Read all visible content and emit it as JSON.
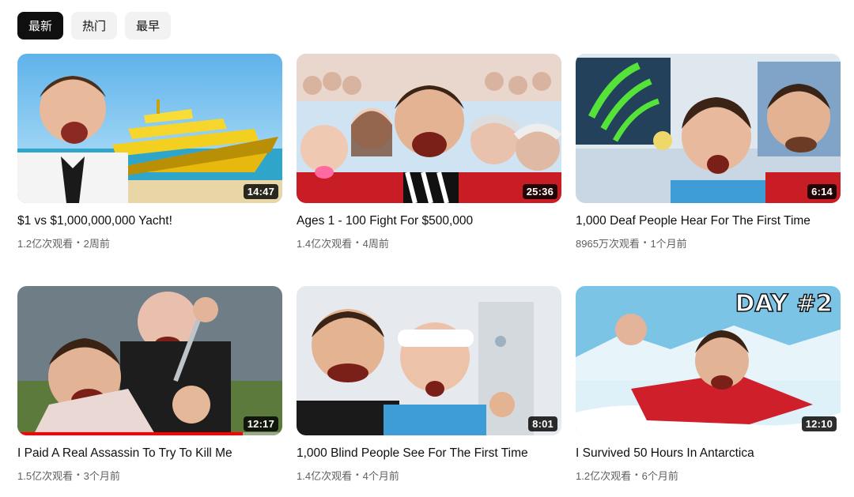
{
  "filters": [
    {
      "label": "最新",
      "active": true
    },
    {
      "label": "热门",
      "active": false
    },
    {
      "label": "最早",
      "active": false
    }
  ],
  "videos": [
    {
      "title": "$1 vs $1,000,000,000 Yacht!",
      "views": "1.2亿次观看",
      "age": "2周前",
      "duration": "14:47"
    },
    {
      "title": "Ages 1 - 100 Fight For $500,000",
      "views": "1.4亿次观看",
      "age": "4周前",
      "duration": "25:36"
    },
    {
      "title": "1,000 Deaf People Hear For The First Time",
      "views": "8965万次观看",
      "age": "1个月前",
      "duration": "6:14"
    },
    {
      "title": "I Paid A Real Assassin To Try To Kill Me",
      "views": "1.5亿次观看",
      "age": "3个月前",
      "duration": "12:17",
      "watched_fraction": 0.85
    },
    {
      "title": "1,000 Blind People See For The First Time",
      "views": "1.4亿次观看",
      "age": "4个月前",
      "duration": "8:01"
    },
    {
      "title": "I Survived 50 Hours In Antarctica",
      "views": "1.2亿次观看",
      "age": "6个月前",
      "duration": "12:10",
      "thumbnail_text": "DAY #2"
    }
  ]
}
